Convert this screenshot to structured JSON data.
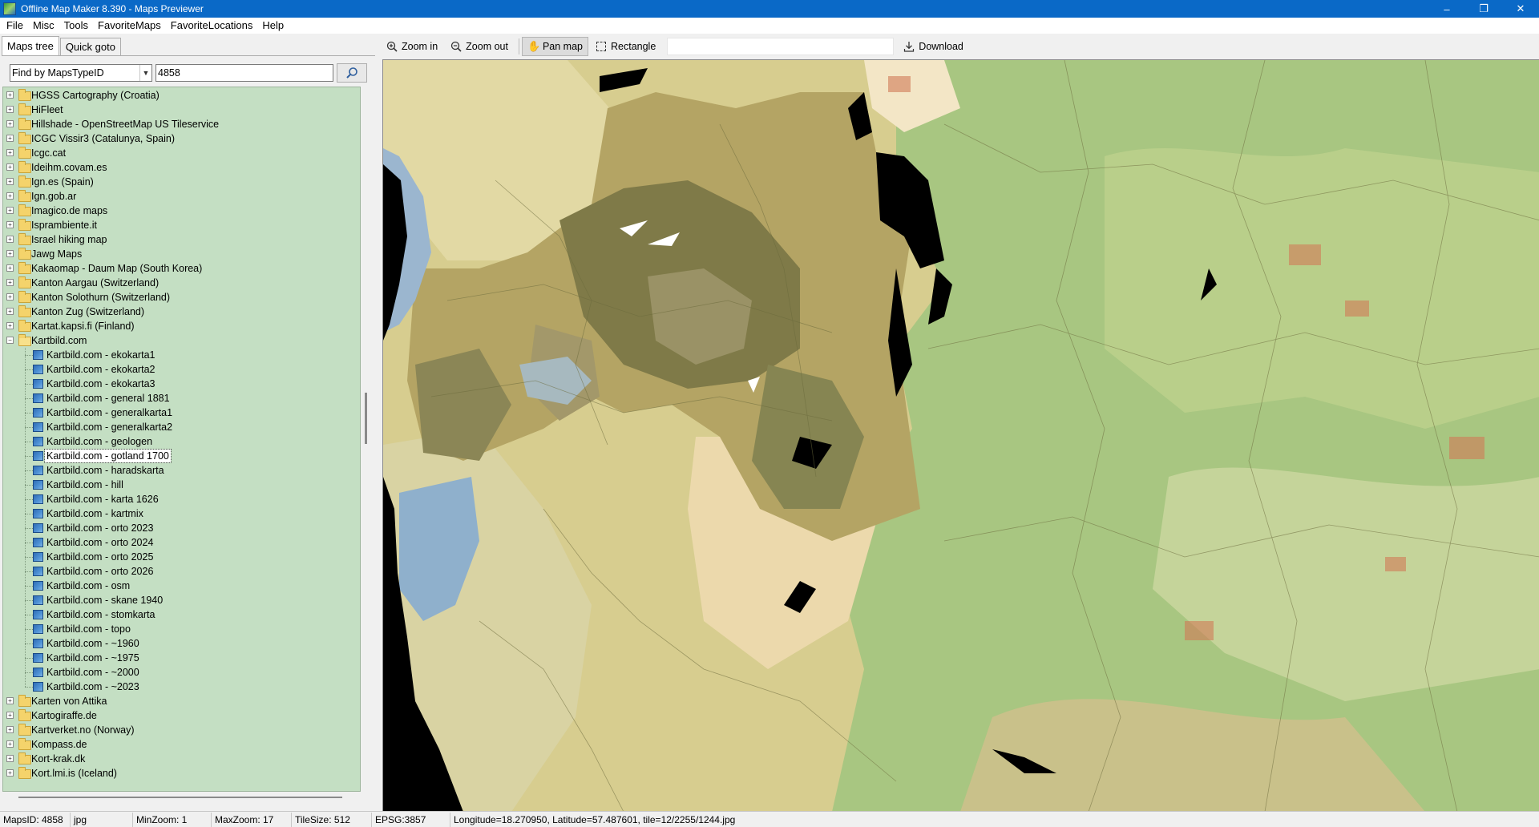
{
  "window": {
    "title": "Offline Map Maker 8.390 - Maps Previewer",
    "controls": {
      "minimize": "–",
      "maximize": "❐",
      "close": "✕"
    }
  },
  "menu": [
    "File",
    "Misc",
    "Tools",
    "FavoriteMaps",
    "FavoriteLocations",
    "Help"
  ],
  "tabs": [
    {
      "label": "Maps tree",
      "active": true
    },
    {
      "label": "Quick goto",
      "active": false
    }
  ],
  "search": {
    "type_selected": "Find by MapsTypeID",
    "value": "4858",
    "button_icon": "search-icon"
  },
  "tree": {
    "before": [
      "HGSS Cartography (Croatia)",
      "HiFleet",
      "Hillshade - OpenStreetMap US Tileservice",
      "ICGC Vissir3 (Catalunya, Spain)",
      "Icgc.cat",
      "Ideihm.covam.es",
      "Ign.es (Spain)",
      "Ign.gob.ar",
      "Imagico.de maps",
      "Isprambiente.it",
      "Israel hiking map",
      "Jawg Maps",
      "Kakaomap - Daum Map (South Korea)",
      "Kanton Aargau (Switzerland)",
      "Kanton Solothurn (Switzerland)",
      "Kanton Zug (Switzerland)",
      "Kartat.kapsi.fi (Finland)"
    ],
    "expanded": {
      "label": "Kartbild.com",
      "children": [
        "Kartbild.com - ekokarta1",
        "Kartbild.com - ekokarta2",
        "Kartbild.com - ekokarta3",
        "Kartbild.com - general 1881",
        "Kartbild.com - generalkarta1",
        "Kartbild.com - generalkarta2",
        "Kartbild.com - geologen",
        "Kartbild.com - gotland 1700",
        "Kartbild.com - haradskarta",
        "Kartbild.com - hill",
        "Kartbild.com - karta 1626",
        "Kartbild.com - kartmix",
        "Kartbild.com - orto 2023",
        "Kartbild.com - orto 2024",
        "Kartbild.com - orto 2025",
        "Kartbild.com - orto 2026",
        "Kartbild.com - osm",
        "Kartbild.com - skane 1940",
        "Kartbild.com - stomkarta",
        "Kartbild.com - topo",
        "Kartbild.com - ~1960",
        "Kartbild.com - ~1975",
        "Kartbild.com - ~2000",
        "Kartbild.com - ~2023"
      ],
      "selected_index": 7
    },
    "after": [
      "Karten von Attika",
      "Kartogiraffe.de",
      "Kartverket.no (Norway)",
      "Kompass.de",
      "Kort-krak.dk",
      "Kort.lmi.is (Iceland)"
    ]
  },
  "toolbar": {
    "zoom_in": "Zoom in",
    "zoom_out": "Zoom out",
    "pan_map": "Pan map",
    "rectangle": "Rectangle",
    "download": "Download"
  },
  "statusbar": {
    "maps_id": "MapsID: 4858",
    "format": "jpg",
    "min_zoom": "MinZoom: 1",
    "max_zoom": "MaxZoom: 17",
    "tile_size": "TileSize: 512",
    "epsg": "EPSG:3857",
    "position": "Longitude=18.270950, Latitude=57.487601, tile=12/2255/1244.jpg"
  },
  "colors": {
    "titlebar": "#0a69c7",
    "tree_background": "#c4dfc3",
    "map_parchment": "#d8cf94",
    "map_green": "#9cc37a",
    "map_olive": "#7d7a45",
    "map_water": "#9bb6cf"
  }
}
